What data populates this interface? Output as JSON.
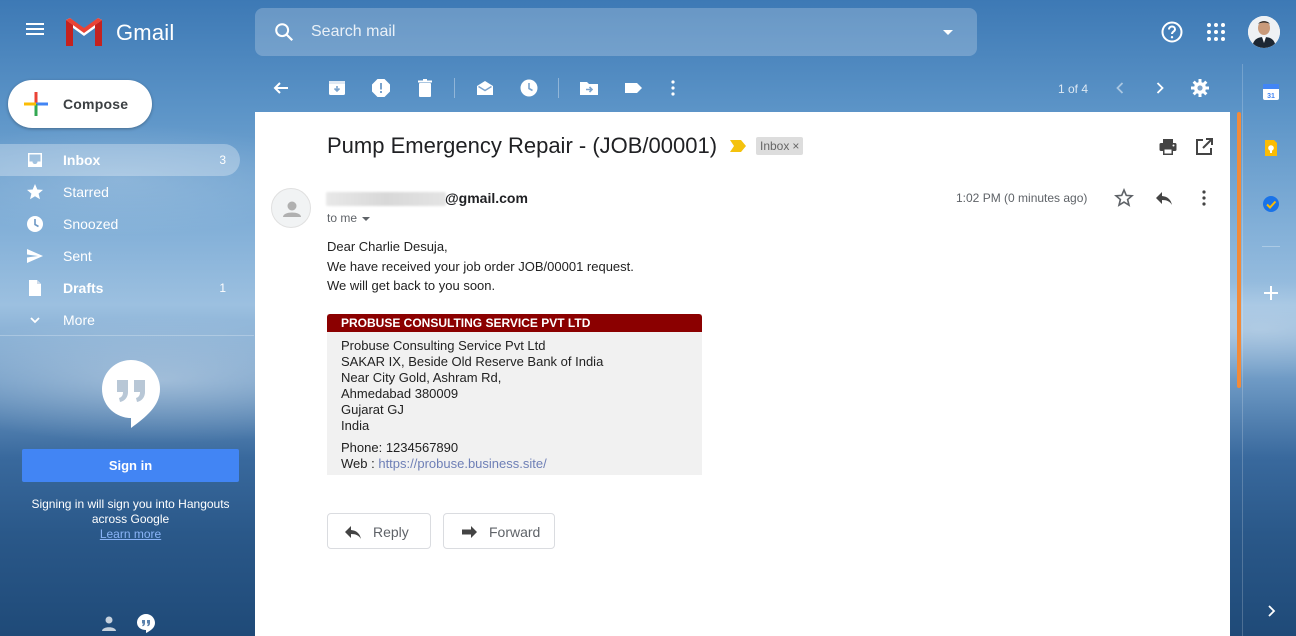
{
  "header": {
    "app_name": "Gmail",
    "search_placeholder": "Search mail"
  },
  "sidebar": {
    "compose_label": "Compose",
    "items": [
      {
        "label": "Inbox",
        "count": "3"
      },
      {
        "label": "Starred",
        "count": ""
      },
      {
        "label": "Snoozed",
        "count": ""
      },
      {
        "label": "Sent",
        "count": ""
      },
      {
        "label": "Drafts",
        "count": "1"
      },
      {
        "label": "More",
        "count": ""
      }
    ],
    "hangouts": {
      "signin_label": "Sign in",
      "note_line1": "Signing in will sign you into Hangouts",
      "note_line2": "across Google",
      "learn_more": "Learn more"
    }
  },
  "toolbar": {
    "pager": "1 of 4"
  },
  "message": {
    "subject": "Pump Emergency Repair - (JOB/00001)",
    "label_chip": "Inbox",
    "label_close": "×",
    "sender_email_suffix": "@gmail.com",
    "to_line": "to me",
    "time": "1:02 PM (0 minutes ago)",
    "body_lines": [
      "Dear Charlie Desuja,",
      "We have received your job order JOB/00001 request.",
      "We will get back to you soon."
    ],
    "signature": {
      "heading": "PROBUSE CONSULTING SERVICE PVT LTD",
      "lines": [
        "Probuse Consulting Service Pvt Ltd",
        "SAKAR IX, Beside Old Reserve Bank of India",
        "Near City Gold, Ashram Rd,",
        "Ahmedabad 380009",
        "Gujarat GJ",
        "India"
      ],
      "phone": "Phone:  1234567890",
      "web_label": "Web : ",
      "web_url": "https://probuse.business.site/"
    },
    "reply_label": "Reply",
    "forward_label": "Forward"
  },
  "colors": {
    "signature_header": "#8b0000",
    "accent_blue": "#4285f4",
    "scroll_accent": "#f28b3a"
  },
  "icons": [
    "menu-icon",
    "gmail-logo",
    "search-icon",
    "help-icon",
    "apps-icon",
    "back-icon",
    "archive-icon",
    "report-spam-icon",
    "delete-icon",
    "mark-unread-icon",
    "snooze-icon",
    "move-to-icon",
    "label-icon",
    "more-icon",
    "settings-icon",
    "print-icon",
    "open-new-window-icon",
    "star-icon",
    "reply-icon",
    "calendar-icon",
    "keep-icon",
    "tasks-icon",
    "add-icon"
  ]
}
